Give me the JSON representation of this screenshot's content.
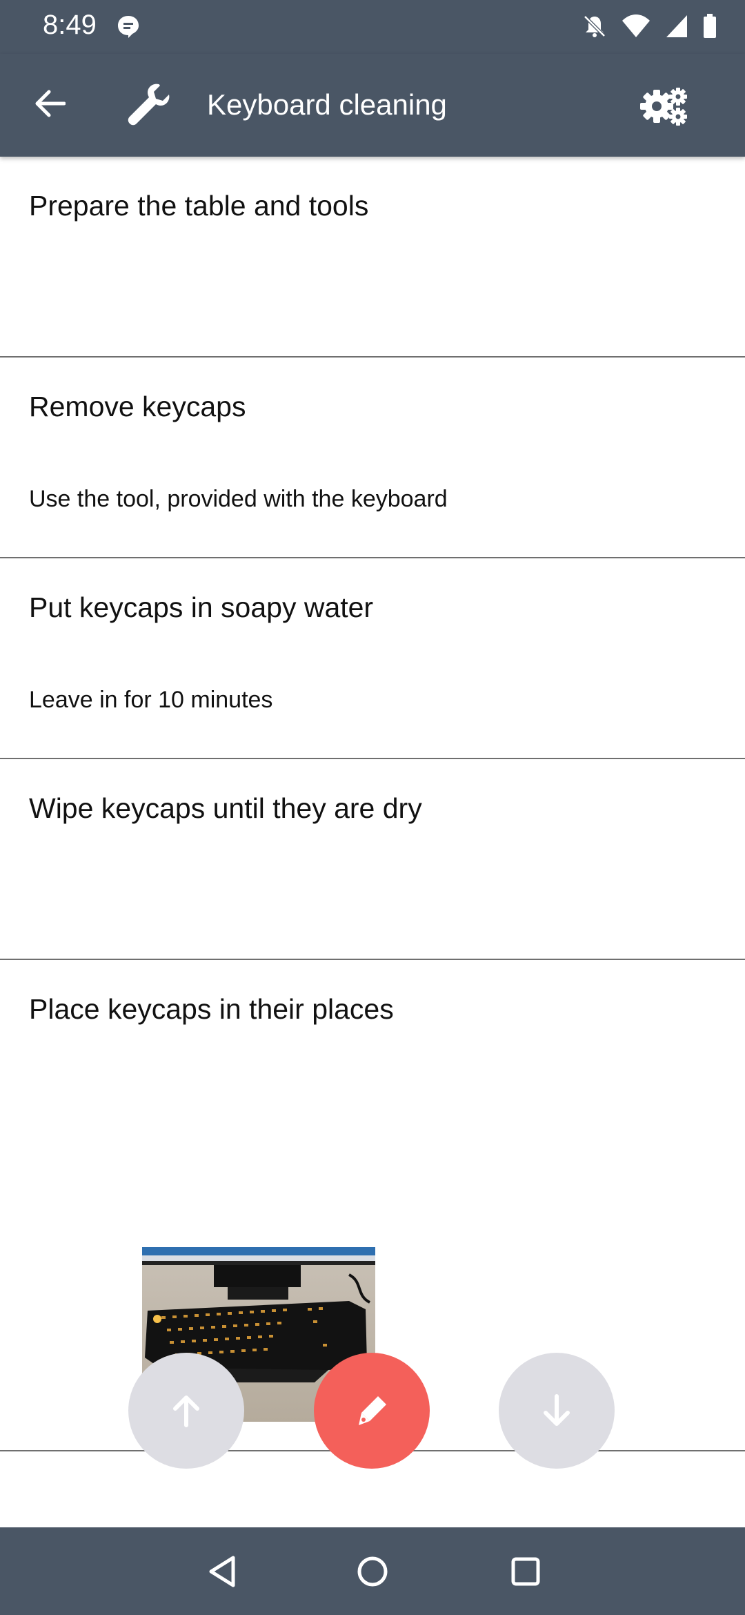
{
  "status_bar": {
    "time": "8:49",
    "left_icon": "chat-notification-icon",
    "right_icons": [
      "notifications-off-icon",
      "wifi-icon",
      "cell-signal-icon",
      "battery-icon"
    ]
  },
  "app_bar": {
    "title": "Keyboard cleaning",
    "back_icon": "arrow-back-icon",
    "logo_icon": "wrench-icon",
    "settings_icon": "settings-gears-icon",
    "background": "#4a5665"
  },
  "steps": [
    {
      "title": "Prepare the table and tools",
      "description": ""
    },
    {
      "title": "Remove keycaps",
      "description": "Use the tool, provided with the keyboard"
    },
    {
      "title": "Put keycaps in soapy water",
      "description": "Leave in for 10 minutes"
    },
    {
      "title": "Wipe keycaps until they are dry",
      "description": ""
    },
    {
      "title": "Place keycaps in their places",
      "description": "",
      "photo": "keyboard-photo"
    }
  ],
  "actions": {
    "move_up_icon": "arrow-up-icon",
    "edit_icon": "pen-icon",
    "move_down_icon": "arrow-down-icon",
    "edit_color": "#f4605a",
    "disabled_color": "#dddde3"
  },
  "nav_bar": {
    "back_icon": "nav-back-triangle-icon",
    "home_icon": "nav-home-circle-icon",
    "recents_icon": "nav-recents-square-icon"
  }
}
